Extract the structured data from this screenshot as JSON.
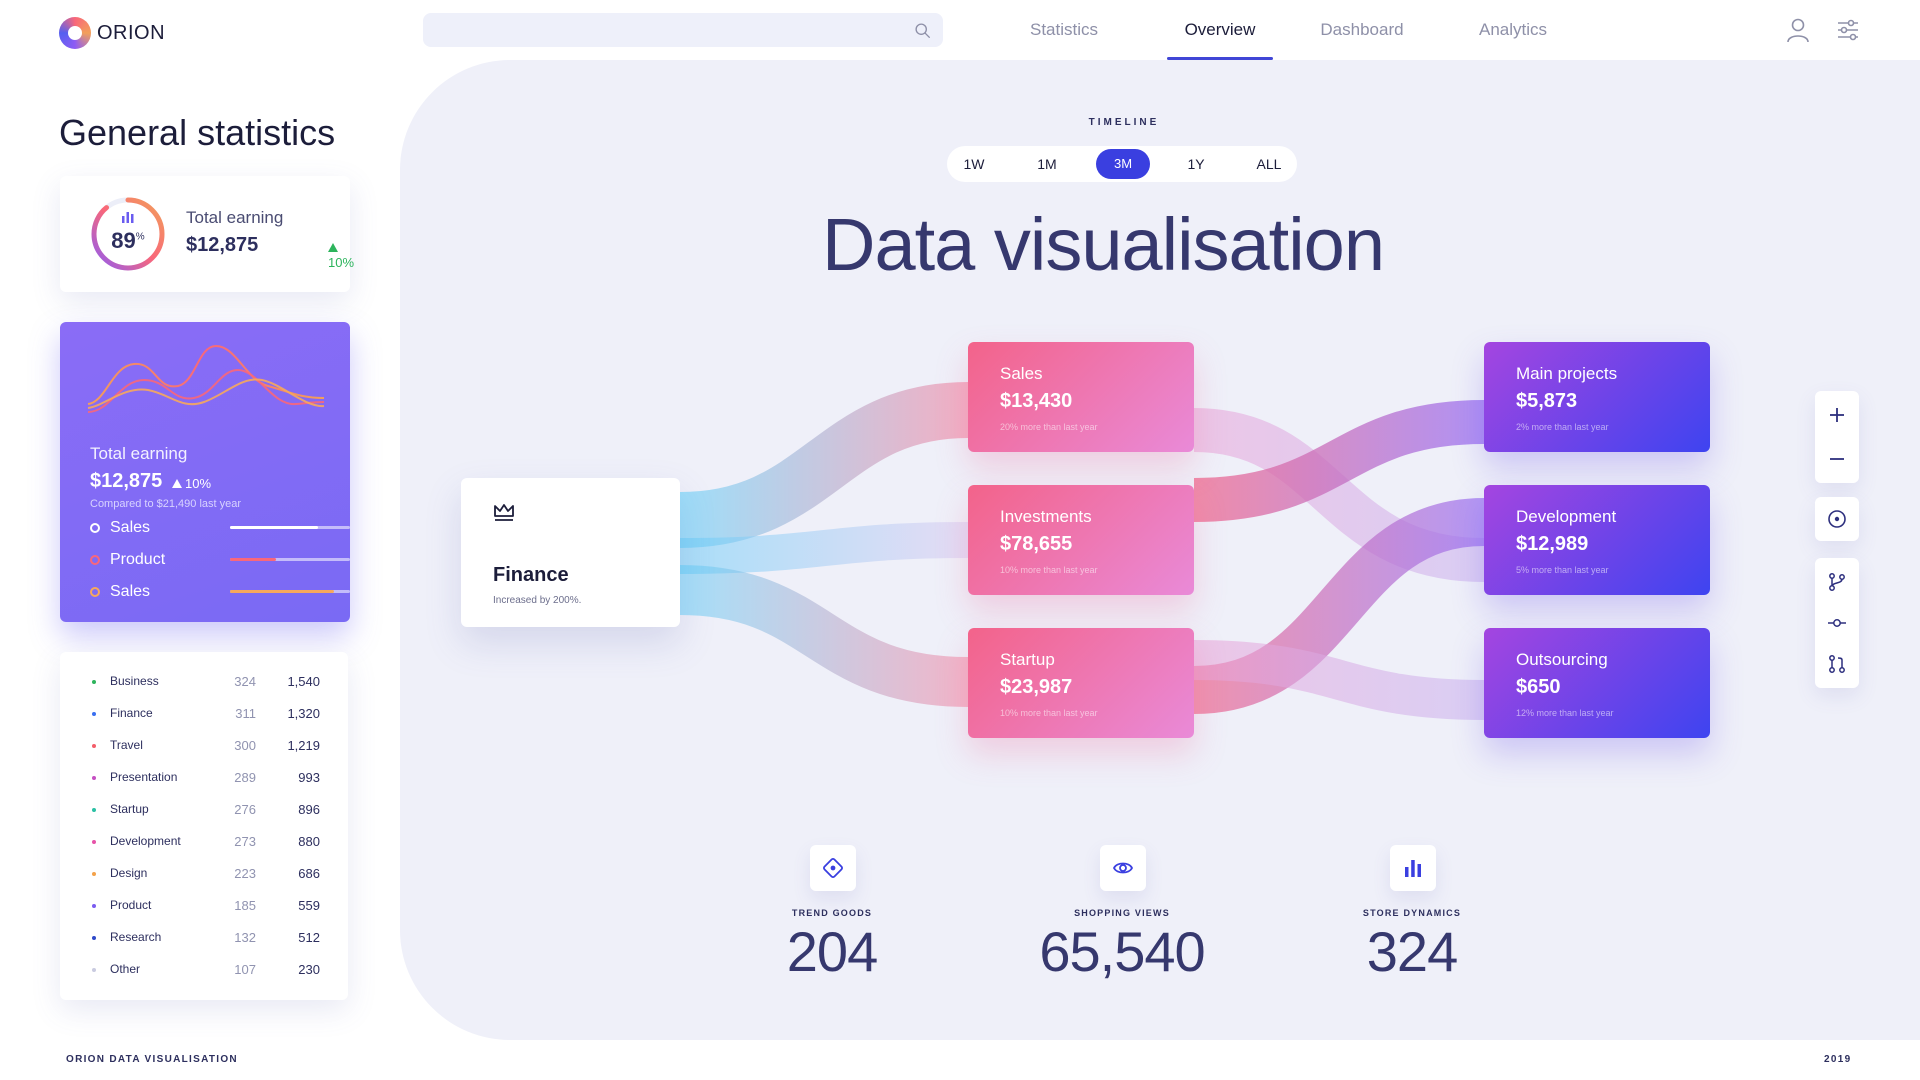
{
  "app": {
    "name": "ORION"
  },
  "search": {
    "placeholder": "",
    "value": ""
  },
  "nav": {
    "tabs": [
      {
        "label": "Statistics",
        "active": false
      },
      {
        "label": "Overview",
        "active": true
      },
      {
        "label": "Dashboard",
        "active": false
      },
      {
        "label": "Analytics",
        "active": false
      }
    ]
  },
  "sidebar": {
    "title": "General statistics",
    "earning_card": {
      "percent": "89",
      "percent_sign": "%",
      "percent_value": 0.89,
      "label": "Total earning",
      "value": "$12,875",
      "change": "10%"
    },
    "purple_card": {
      "label": "Total earning",
      "value": "$12,875",
      "change": "10%",
      "compare": "Compared to $21,490 last year",
      "rows": [
        {
          "name": "Sales",
          "fill": 0.73,
          "color": "#ffffff"
        },
        {
          "name": "Product",
          "fill": 0.38,
          "color": "#f9677a"
        },
        {
          "name": "Sales",
          "fill": 0.87,
          "color": "#f7a85c"
        }
      ]
    },
    "list": [
      {
        "name": "Business",
        "a": "324",
        "b": "1,540",
        "color": "#2db45c"
      },
      {
        "name": "Finance",
        "a": "311",
        "b": "1,320",
        "color": "#3a6ff0"
      },
      {
        "name": "Travel",
        "a": "300",
        "b": "1,219",
        "color": "#f35e6a"
      },
      {
        "name": "Presentation",
        "a": "289",
        "b": "993",
        "color": "#c54fc2"
      },
      {
        "name": "Startup",
        "a": "276",
        "b": "896",
        "color": "#2bc0a4"
      },
      {
        "name": "Development",
        "a": "273",
        "b": "880",
        "color": "#e653a8"
      },
      {
        "name": "Design",
        "a": "223",
        "b": "686",
        "color": "#f3a24a"
      },
      {
        "name": "Product",
        "a": "185",
        "b": "559",
        "color": "#7b5cf0"
      },
      {
        "name": "Research",
        "a": "132",
        "b": "512",
        "color": "#2f49c9"
      },
      {
        "name": "Other",
        "a": "107",
        "b": "230",
        "color": "#c9cbe0"
      }
    ]
  },
  "main": {
    "timeline_label": "TIMELINE",
    "timeline": [
      {
        "label": "1W",
        "active": false
      },
      {
        "label": "1M",
        "active": false
      },
      {
        "label": "3M",
        "active": true
      },
      {
        "label": "1Y",
        "active": false
      },
      {
        "label": "ALL",
        "active": false
      }
    ],
    "title": "Data visualisation",
    "finance": {
      "title": "Finance",
      "subtitle": "Increased by 200%."
    },
    "middle_nodes": [
      {
        "label": "Sales",
        "value": "$13,430",
        "sub": "20% more than last year"
      },
      {
        "label": "Investments",
        "value": "$78,655",
        "sub": "10% more than last year"
      },
      {
        "label": "Startup",
        "value": "$23,987",
        "sub": "10% more than last year"
      }
    ],
    "right_nodes": [
      {
        "label": "Main projects",
        "value": "$5,873",
        "sub": "2% more than last year"
      },
      {
        "label": "Development",
        "value": "$12,989",
        "sub": "5% more than last year"
      },
      {
        "label": "Outsourcing",
        "value": "$650",
        "sub": "12% more than last year"
      }
    ],
    "stats": [
      {
        "label": "TREND GOODS",
        "value": "204",
        "icon": "target-icon"
      },
      {
        "label": "SHOPPING VIEWS",
        "value": "65,540",
        "icon": "eye-icon"
      },
      {
        "label": "STORE DYNAMICS",
        "value": "324",
        "icon": "bar-chart-icon"
      }
    ]
  },
  "toolbar": {
    "icons": [
      "plus-icon",
      "minus-icon",
      "target-circle-icon",
      "branch-icon",
      "commit-icon",
      "pull-request-icon"
    ]
  },
  "footer": {
    "left": "ORION DATA VISUALISATION",
    "right": "2019"
  },
  "colors": {
    "accent": "#3a3fe0",
    "pink_gradient": [
      "#f3638a",
      "#e98ad8"
    ],
    "violet_gradient": [
      "#a445e0",
      "#3e44f0"
    ],
    "panel_bg": "#eff0f9"
  }
}
